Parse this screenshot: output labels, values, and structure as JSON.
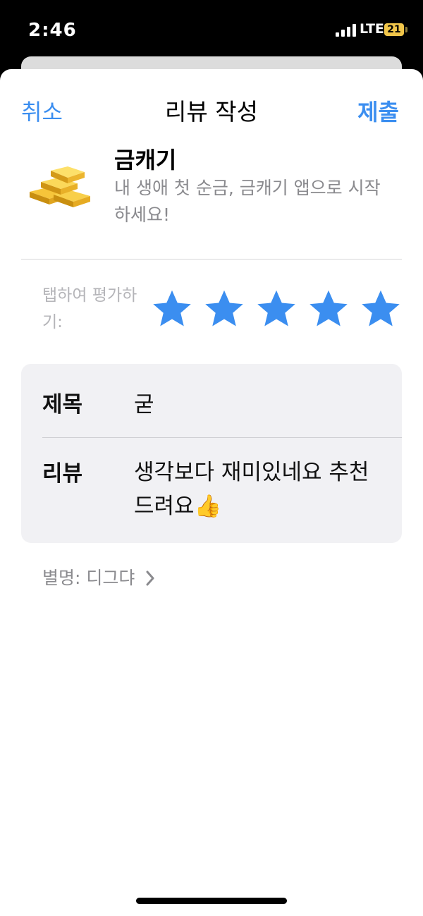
{
  "status_bar": {
    "time": "2:46",
    "network": "LTE",
    "battery": "21"
  },
  "nav": {
    "cancel": "취소",
    "title": "리뷰 작성",
    "submit": "제출"
  },
  "app": {
    "name": "금캐기",
    "subtitle": "내 생애 첫 순금, 금캐기 앱으로 시작하세요!",
    "icon": "gold-bars-icon"
  },
  "rating": {
    "label": "탭하여 평가하기:",
    "stars": 5,
    "max": 5,
    "star_color": "#3b8ef0"
  },
  "form": {
    "title_label": "제목",
    "title_value": "굳",
    "review_label": "리뷰",
    "review_value": "생각보다 재미있네요 추천드려요👍"
  },
  "nickname": {
    "text": "별명: 디그댜"
  },
  "colors": {
    "accent": "#3b8ef0",
    "secondary_text": "#8a8a8e",
    "card_bg": "#f1f1f4"
  }
}
